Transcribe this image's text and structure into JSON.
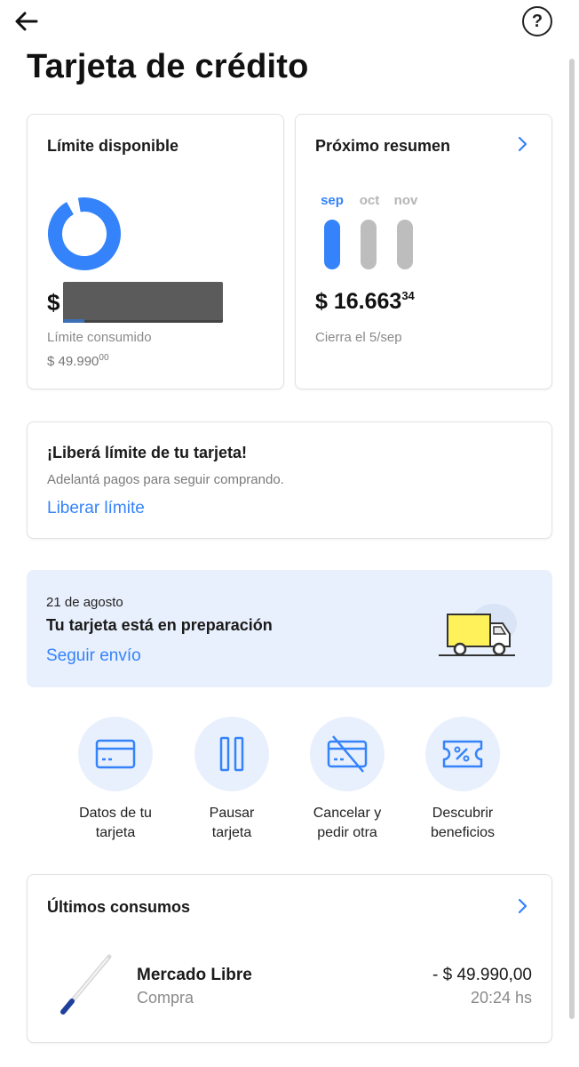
{
  "header": {
    "back_icon": "arrow-left-icon",
    "help_icon": "help-circle-icon",
    "help_glyph": "?",
    "title": "Tarjeta de crédito"
  },
  "limit_card": {
    "heading": "Límite disponible",
    "currency_symbol": "$",
    "consumed_label": "Límite consumido",
    "consumed_amount": "$ 49.990",
    "consumed_cents": "00",
    "donut_icon": "donut-ring-icon"
  },
  "resumen_card": {
    "heading": "Próximo resumen",
    "months": [
      {
        "label": "sep",
        "active": true
      },
      {
        "label": "oct",
        "active": false
      },
      {
        "label": "nov",
        "active": false
      }
    ],
    "amount": "$ 16.663",
    "amount_cents": "34",
    "closing_text": "Cierra el 5/sep"
  },
  "liberar_card": {
    "title": "¡Liberá límite de tu tarjeta!",
    "description": "Adelantá pagos para seguir comprando.",
    "link": "Liberar límite"
  },
  "envio_banner": {
    "date": "21 de agosto",
    "title": "Tu tarjeta está en preparación",
    "link": "Seguir envío",
    "illustration": "delivery-truck-icon"
  },
  "actions": [
    {
      "label": "Datos de tu\ntarjeta",
      "icon": "credit-card-icon"
    },
    {
      "label": "Pausar\ntarjeta",
      "icon": "pause-icon"
    },
    {
      "label": "Cancelar y\npedir otra",
      "icon": "card-cancel-icon"
    },
    {
      "label": "Descubrir\nbeneficios",
      "icon": "discount-ticket-icon"
    }
  ],
  "consumos": {
    "title": "Últimos consumos",
    "transactions": [
      {
        "merchant": "Mercado Libre",
        "type": "Compra",
        "amount": "- $ 49.990,00",
        "time": "20:24 hs"
      }
    ]
  },
  "colors": {
    "accent": "#3483fa",
    "banner_bg": "#e9f0fd",
    "inactive_bar": "#bdbdbd",
    "truck_cargo": "#fff159"
  }
}
